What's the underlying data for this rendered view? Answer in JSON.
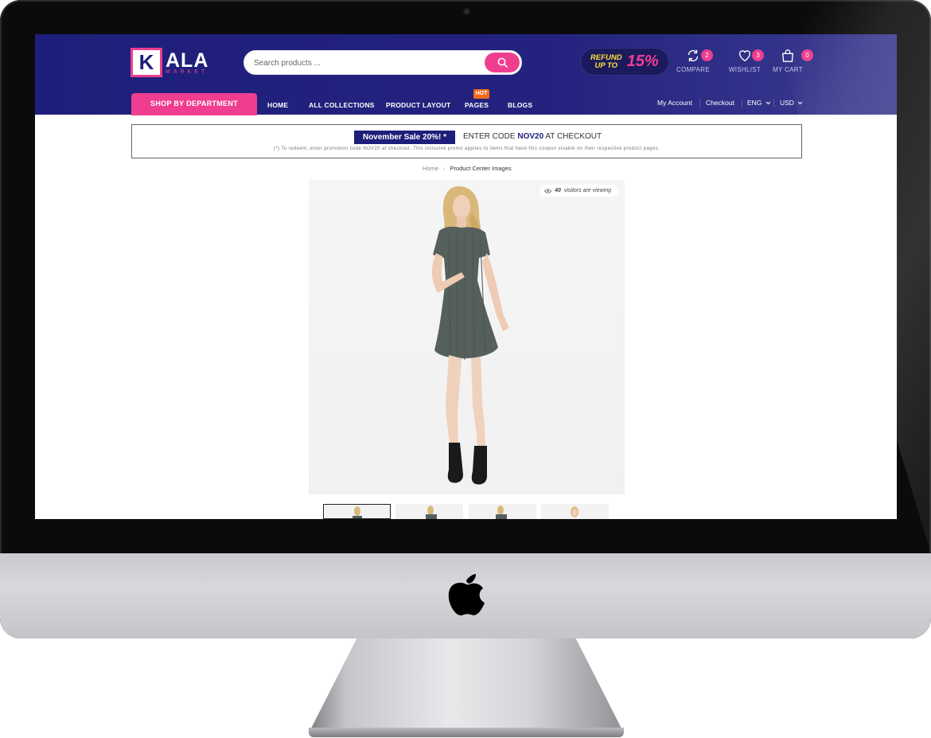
{
  "header": {
    "logo": {
      "letter": "K",
      "main": "ALA",
      "sub": "MARKET"
    },
    "search": {
      "placeholder": "Search products ..."
    },
    "promo_badge": {
      "line1": "REFUND",
      "line2": "UP TO",
      "value": "15%"
    },
    "compare": {
      "label": "COMPARE",
      "count": "2"
    },
    "wishlist": {
      "label": "WISHLIST",
      "count": "3"
    },
    "cart": {
      "label": "MY CART",
      "count": "0"
    }
  },
  "nav": {
    "department": "SHOP BY DEPARTMENT",
    "items": [
      "HOME",
      "ALL COLLECTIONS",
      "PRODUCT LAYOUT",
      "PAGES",
      "BLOGS"
    ],
    "hot_label": "HOT",
    "account": "My Account",
    "checkout": "Checkout",
    "language": "ENG",
    "currency": "USD"
  },
  "promo": {
    "tag": "November Sale 20%! *",
    "code_prefix": "ENTER CODE",
    "code": "NOV20",
    "code_suffix": "AT CHECKOUT",
    "note": "(*) To redeem, enter promotion code NOV20 at checkout. This inclusive promo applies to items that have this coupon visable on their respective product pages."
  },
  "breadcrumb": {
    "home": "Home",
    "current": "Product Center Images"
  },
  "product": {
    "visitors_count": "40",
    "visitors_text": "visitors are viewing",
    "thumbnail_count": 4
  },
  "colors": {
    "brand_navy": "#1e1f7a",
    "brand_pink": "#ef3e8f",
    "hot_orange": "#f26a1b",
    "dress": "#55605c"
  }
}
